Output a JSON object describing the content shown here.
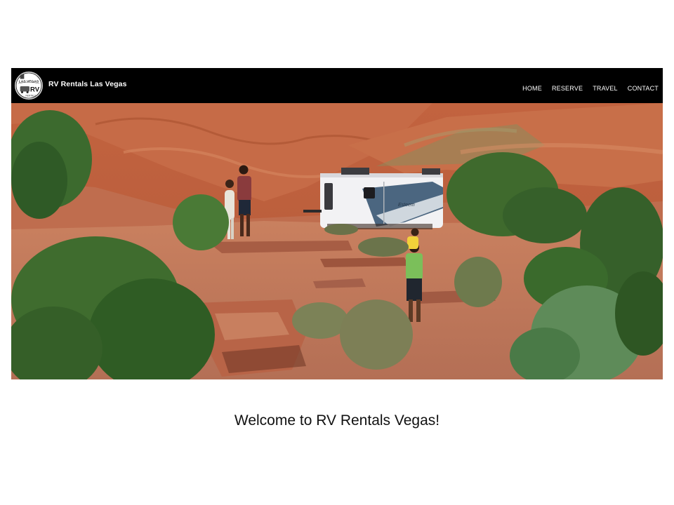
{
  "header": {
    "logo": {
      "icon": "las-vegas-rv-badge-icon",
      "text_top": "LAS VEGAS",
      "text_badge": "RV",
      "text_bottom": "RENTALS"
    },
    "site_title": "RV Rentals Las Vegas",
    "nav": [
      "HOME",
      "RESERVE",
      "TRAVEL",
      "CONTACT"
    ]
  },
  "hero": {
    "trailer_text": "Esteem"
  },
  "main": {
    "heading": "Welcome to RV Rentals Vegas!"
  },
  "colors": {
    "nav_bg": "#000000",
    "nav_text": "#ffffff",
    "page_bg": "#ffffff",
    "heading": "#111111"
  }
}
